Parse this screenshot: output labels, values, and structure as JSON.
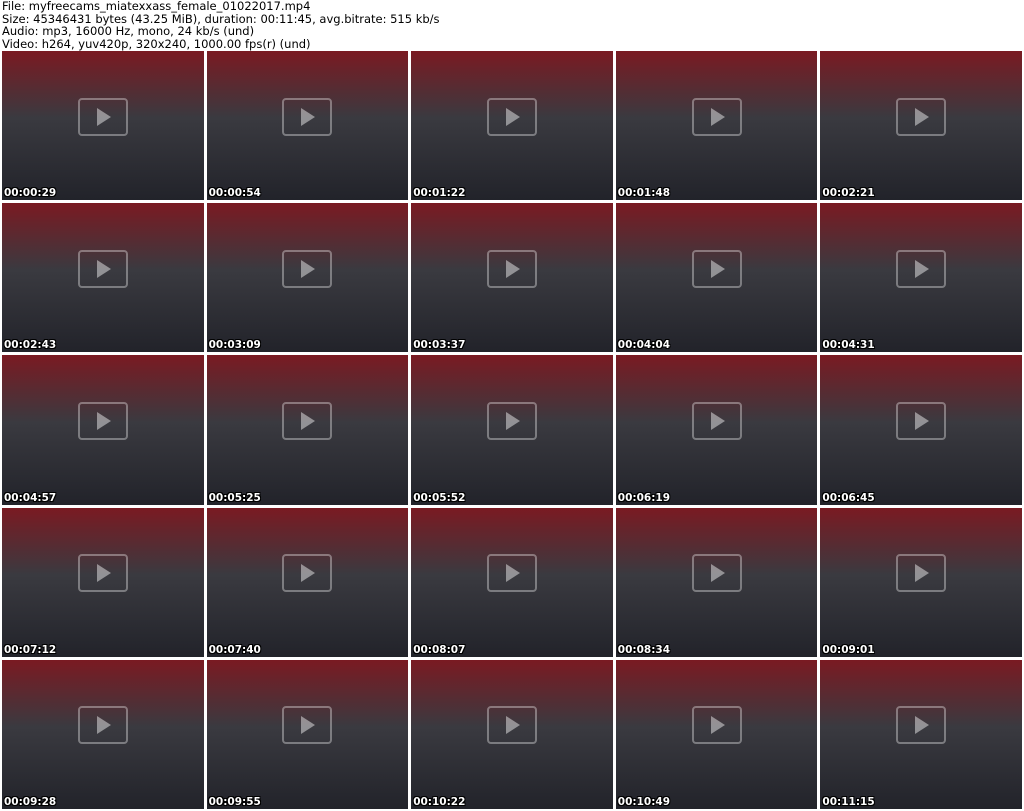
{
  "header": {
    "file_line": "File: myfreecams_miatexxass_female_01022017.mp4",
    "size_line": "Size: 45346431 bytes (43.25 MiB), duration: 00:11:45, avg.bitrate: 515 kb/s",
    "audio_line": "Audio: mp3, 16000 Hz, mono, 24 kb/s (und)",
    "video_line": "Video: h264, yuv420p, 320x240, 1000.00 fps(r) (und)"
  },
  "frames": [
    {
      "timestamp": "00:00:29"
    },
    {
      "timestamp": "00:00:54"
    },
    {
      "timestamp": "00:01:22"
    },
    {
      "timestamp": "00:01:48"
    },
    {
      "timestamp": "00:02:21"
    },
    {
      "timestamp": "00:02:43"
    },
    {
      "timestamp": "00:03:09"
    },
    {
      "timestamp": "00:03:37"
    },
    {
      "timestamp": "00:04:04"
    },
    {
      "timestamp": "00:04:31"
    },
    {
      "timestamp": "00:04:57"
    },
    {
      "timestamp": "00:05:25"
    },
    {
      "timestamp": "00:05:52"
    },
    {
      "timestamp": "00:06:19"
    },
    {
      "timestamp": "00:06:45"
    },
    {
      "timestamp": "00:07:12"
    },
    {
      "timestamp": "00:07:40"
    },
    {
      "timestamp": "00:08:07"
    },
    {
      "timestamp": "00:08:34"
    },
    {
      "timestamp": "00:09:01"
    },
    {
      "timestamp": "00:09:28"
    },
    {
      "timestamp": "00:09:55"
    },
    {
      "timestamp": "00:10:22"
    },
    {
      "timestamp": "00:10:49"
    },
    {
      "timestamp": "00:11:15"
    }
  ]
}
